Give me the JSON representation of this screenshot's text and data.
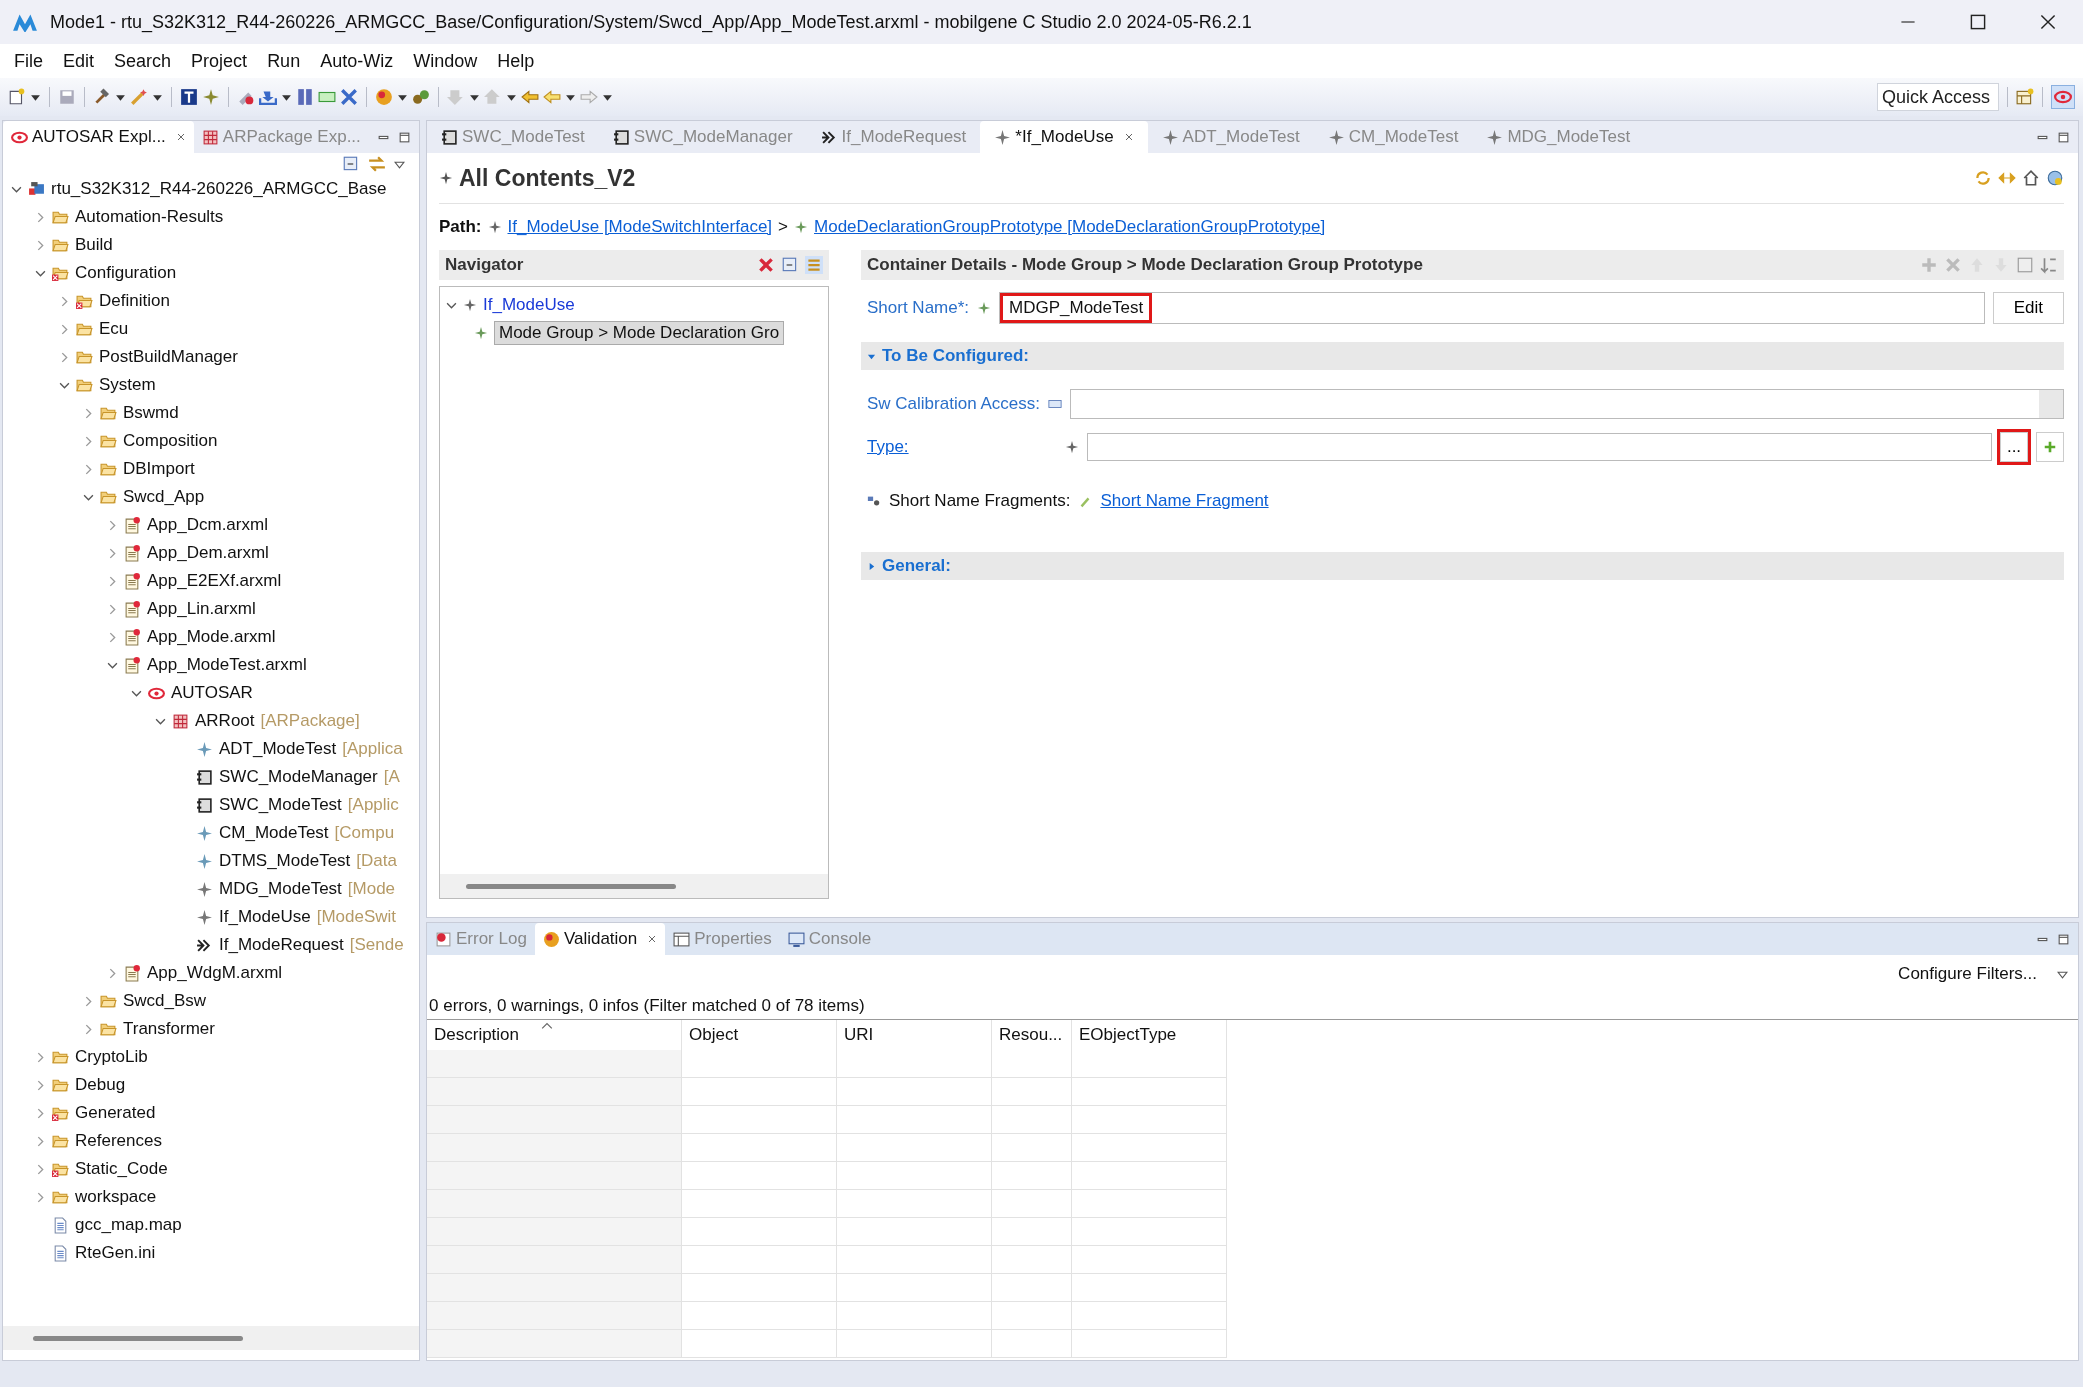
{
  "window": {
    "title": "Mode1 - rtu_S32K312_R44-260226_ARMGCC_Base/Configuration/System/Swcd_App/App_ModeTest.arxml - mobilgene C Studio 2.0 2024-05-R6.2.1"
  },
  "menu": [
    "File",
    "Edit",
    "Search",
    "Project",
    "Run",
    "Auto-Wiz",
    "Window",
    "Help"
  ],
  "quick_access": {
    "placeholder": "Quick Access"
  },
  "explorer_tabs": [
    {
      "label": "AUTOSAR Expl...",
      "selected": true
    },
    {
      "label": "ARPackage Exp...",
      "selected": false
    }
  ],
  "tree": [
    {
      "label": "rtu_S32K312_R44-260226_ARMGCC_Base",
      "kind": "project",
      "expanded": true,
      "children": [
        {
          "label": "Automation-Results",
          "kind": "folder",
          "expanded": false
        },
        {
          "label": "Build",
          "kind": "folder",
          "expanded": false
        },
        {
          "label": "Configuration",
          "kind": "folder-error",
          "expanded": true,
          "children": [
            {
              "label": "Definition",
              "kind": "folder-error",
              "expanded": false
            },
            {
              "label": "Ecu",
              "kind": "folder",
              "expanded": false
            },
            {
              "label": "PostBuildManager",
              "kind": "folder",
              "expanded": false
            },
            {
              "label": "System",
              "kind": "folder",
              "expanded": true,
              "children": [
                {
                  "label": "Bswmd",
                  "kind": "folder",
                  "expanded": false
                },
                {
                  "label": "Composition",
                  "kind": "folder",
                  "expanded": false
                },
                {
                  "label": "DBImport",
                  "kind": "folder",
                  "expanded": false
                },
                {
                  "label": "Swcd_App",
                  "kind": "folder",
                  "expanded": true,
                  "children": [
                    {
                      "label": "App_Dcm.arxml",
                      "kind": "arxml",
                      "expanded": false
                    },
                    {
                      "label": "App_Dem.arxml",
                      "kind": "arxml",
                      "expanded": false
                    },
                    {
                      "label": "App_E2EXf.arxml",
                      "kind": "arxml",
                      "expanded": false
                    },
                    {
                      "label": "App_Lin.arxml",
                      "kind": "arxml",
                      "expanded": false
                    },
                    {
                      "label": "App_Mode.arxml",
                      "kind": "arxml",
                      "expanded": false
                    },
                    {
                      "label": "App_ModeTest.arxml",
                      "kind": "arxml",
                      "expanded": true,
                      "children": [
                        {
                          "label": "AUTOSAR",
                          "kind": "autosar",
                          "expanded": true,
                          "children": [
                            {
                              "label": "ARRoot",
                              "type_label": "[ARPackage]",
                              "kind": "package",
                              "expanded": true,
                              "children": [
                                {
                                  "label": "ADT_ModeTest",
                                  "type_label": "[Applica",
                                  "kind": "datatype"
                                },
                                {
                                  "label": "SWC_ModeManager",
                                  "type_label": "[A",
                                  "kind": "component"
                                },
                                {
                                  "label": "SWC_ModeTest",
                                  "type_label": "[Applic",
                                  "kind": "component"
                                },
                                {
                                  "label": "CM_ModeTest",
                                  "type_label": "[Compu",
                                  "kind": "datatype"
                                },
                                {
                                  "label": "DTMS_ModeTest",
                                  "type_label": "[Data",
                                  "kind": "datatype"
                                },
                                {
                                  "label": "MDG_ModeTest",
                                  "type_label": "[Mode",
                                  "kind": "interface"
                                },
                                {
                                  "label": "If_ModeUse",
                                  "type_label": "[ModeSwit",
                                  "kind": "interface"
                                },
                                {
                                  "label": "If_ModeRequest",
                                  "type_label": "[Sende",
                                  "kind": "sender"
                                }
                              ]
                            }
                          ]
                        }
                      ]
                    },
                    {
                      "label": "App_WdgM.arxml",
                      "kind": "arxml",
                      "expanded": false
                    }
                  ]
                },
                {
                  "label": "Swcd_Bsw",
                  "kind": "folder",
                  "expanded": false
                },
                {
                  "label": "Transformer",
                  "kind": "folder",
                  "expanded": false
                }
              ]
            }
          ]
        },
        {
          "label": "CryptoLib",
          "kind": "folder",
          "expanded": false
        },
        {
          "label": "Debug",
          "kind": "folder",
          "expanded": false
        },
        {
          "label": "Generated",
          "kind": "folder-error",
          "expanded": false
        },
        {
          "label": "References",
          "kind": "folder",
          "expanded": false
        },
        {
          "label": "Static_Code",
          "kind": "folder-error",
          "expanded": false
        },
        {
          "label": "workspace",
          "kind": "folder",
          "expanded": false
        },
        {
          "label": "gcc_map.map",
          "kind": "file"
        },
        {
          "label": "RteGen.ini",
          "kind": "file"
        }
      ]
    }
  ],
  "editor_tabs": [
    {
      "label": "SWC_ModeTest",
      "kind": "component",
      "selected": false
    },
    {
      "label": "SWC_ModeManager",
      "kind": "component",
      "selected": false
    },
    {
      "label": "If_ModeRequest",
      "kind": "sender",
      "selected": false
    },
    {
      "label": "*If_ModeUse",
      "kind": "interface",
      "selected": true
    },
    {
      "label": "ADT_ModeTest",
      "kind": "interface",
      "selected": false
    },
    {
      "label": "CM_ModeTest",
      "kind": "interface",
      "selected": false
    },
    {
      "label": "MDG_ModeTest",
      "kind": "interface",
      "selected": false
    }
  ],
  "editor": {
    "title": "All Contents_V2",
    "path": {
      "label": "Path:",
      "links": [
        "If_ModeUse [ModeSwitchInterface]",
        "ModeDeclarationGroupPrototype [ModeDeclarationGroupPrototype]"
      ],
      "separator": ">"
    },
    "navigator": {
      "title": "Navigator",
      "items": [
        {
          "label": "If_ModeUse",
          "expanded": true,
          "selected": false,
          "children": [
            {
              "label": "Mode Group > Mode Declaration Gro",
              "selected": true
            }
          ]
        }
      ]
    },
    "details": {
      "title": "Container Details - Mode Group > Mode Declaration Group Prototype",
      "short_name": {
        "label": "Short Name*:",
        "value": "MDGP_ModeTest",
        "highlighted": true,
        "button": "Edit"
      },
      "sections": [
        {
          "title": "To Be Configured:",
          "expanded": true,
          "fields": [
            {
              "kind": "combo",
              "label": "Sw Calibration Access:"
            },
            {
              "kind": "reference",
              "label": "Type:",
              "browse": "...",
              "browse_highlighted": true
            },
            {
              "kind": "fragments",
              "label": "Short Name Fragments:",
              "link": "Short Name Fragment"
            }
          ]
        },
        {
          "title": "General:",
          "expanded": false
        }
      ]
    }
  },
  "bottom_tabs": [
    {
      "label": "Error Log",
      "kind": "error",
      "selected": false
    },
    {
      "label": "Validation",
      "kind": "warning",
      "selected": true
    },
    {
      "label": "Properties",
      "kind": "table",
      "selected": false
    },
    {
      "label": "Console",
      "kind": "console",
      "selected": false
    }
  ],
  "validation": {
    "configure": "Configure Filters...",
    "summary": "0 errors, 0 warnings, 0 infos (Filter matched 0 of 78 items)",
    "columns": [
      {
        "label": "Description",
        "sorted": true
      },
      {
        "label": "Object",
        "sorted": false
      },
      {
        "label": "URI",
        "sorted": false
      },
      {
        "label": "Resou...",
        "sorted": false
      },
      {
        "label": "EObjectType",
        "sorted": false
      }
    ]
  }
}
